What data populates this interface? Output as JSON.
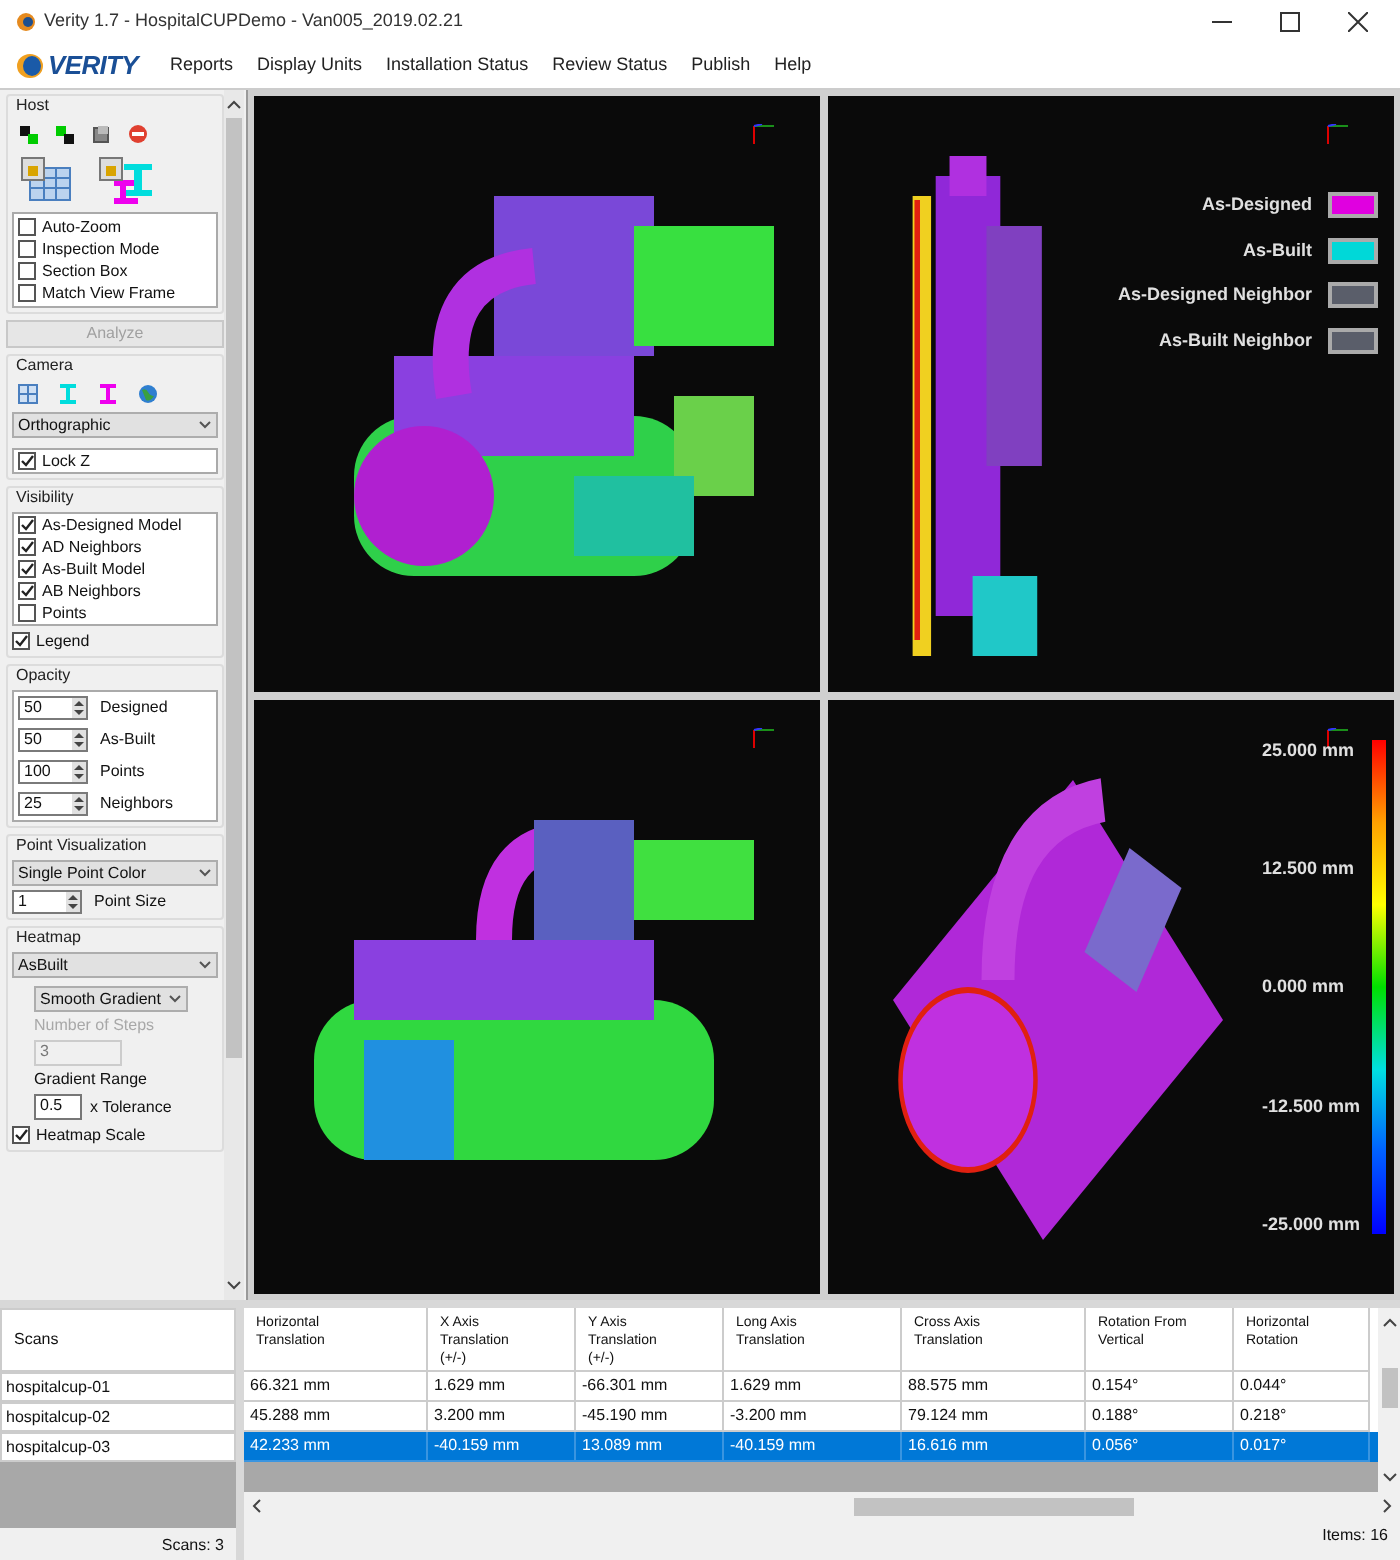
{
  "window": {
    "title": "Verity 1.7 - HospitalCUPDemo - Van005_2019.02.21"
  },
  "menu": {
    "logo": "VERITY",
    "items": [
      "Reports",
      "Display Units",
      "Installation Status",
      "Review Status",
      "Publish",
      "Help"
    ]
  },
  "host": {
    "title": "Host",
    "options": [
      {
        "label": "Auto-Zoom",
        "checked": false
      },
      {
        "label": "Inspection Mode",
        "checked": false
      },
      {
        "label": "Section Box",
        "checked": false
      },
      {
        "label": "Match View Frame",
        "checked": false
      }
    ],
    "analyze": {
      "label": "Analyze",
      "disabled": true
    }
  },
  "camera": {
    "title": "Camera",
    "projection": "Orthographic",
    "lock_z": {
      "label": "Lock Z",
      "checked": true
    }
  },
  "visibility": {
    "title": "Visibility",
    "items": [
      {
        "label": "As-Designed Model",
        "checked": true
      },
      {
        "label": "AD Neighbors",
        "checked": true
      },
      {
        "label": "As-Built Model",
        "checked": true
      },
      {
        "label": "AB Neighbors",
        "checked": true
      },
      {
        "label": "Points",
        "checked": false
      }
    ],
    "legend": {
      "label": "Legend",
      "checked": true
    }
  },
  "opacity": {
    "title": "Opacity",
    "rows": [
      {
        "value": "50",
        "label": "Designed"
      },
      {
        "value": "50",
        "label": "As-Built"
      },
      {
        "value": "100",
        "label": "Points"
      },
      {
        "value": "25",
        "label": "Neighbors"
      }
    ]
  },
  "point_visualization": {
    "title": "Point Visualization",
    "mode": "Single Point Color",
    "point_size": {
      "value": "1",
      "label": "Point Size"
    }
  },
  "heatmap": {
    "title": "Heatmap",
    "source": "AsBuilt",
    "gradient": "Smooth Gradient",
    "steps": {
      "label": "Number of Steps",
      "value": "3",
      "disabled": true
    },
    "range_label": "Gradient Range",
    "tolerance": {
      "value": "0.5",
      "label": "x Tolerance"
    },
    "scale": {
      "label": "Heatmap Scale",
      "checked": true
    }
  },
  "viewports": {
    "legend": [
      {
        "label": "As-Designed",
        "color": "#e000e0"
      },
      {
        "label": "As-Built",
        "color": "#00d8d8"
      },
      {
        "label": "As-Designed Neighbor",
        "color": "#5a5e6a"
      },
      {
        "label": "As-Built Neighbor",
        "color": "#5a5e6a"
      }
    ],
    "scale": [
      "25.000 mm",
      "12.500 mm",
      "0.000 mm",
      "-12.500 mm",
      "-25.000 mm"
    ]
  },
  "scans": {
    "header": "Scans",
    "items": [
      "hospitalcup-01",
      "hospitalcup-02",
      "hospitalcup-03"
    ],
    "footer": "Scans: 3"
  },
  "table": {
    "columns": [
      "Horizontal\nTranslation",
      "X Axis\nTranslation\n(+/-)",
      "Y Axis\nTranslation\n(+/-)",
      "Long Axis\nTranslation",
      "Cross Axis\nTranslation",
      "Rotation From\nVertical",
      "Horizontal\nRotation"
    ],
    "rows": [
      {
        "cells": [
          "66.321 mm",
          "1.629 mm",
          "-66.301 mm",
          "1.629 mm",
          "88.575 mm",
          "0.154°",
          "0.044°"
        ],
        "selected": false
      },
      {
        "cells": [
          "45.288 mm",
          "3.200 mm",
          "-45.190 mm",
          "-3.200 mm",
          "79.124 mm",
          "0.188°",
          "0.218°"
        ],
        "selected": false
      },
      {
        "cells": [
          "42.233 mm",
          "-40.159 mm",
          "13.089 mm",
          "-40.159 mm",
          "16.616 mm",
          "0.056°",
          "0.017°"
        ],
        "selected": true
      }
    ],
    "footer": "Items: 16"
  }
}
